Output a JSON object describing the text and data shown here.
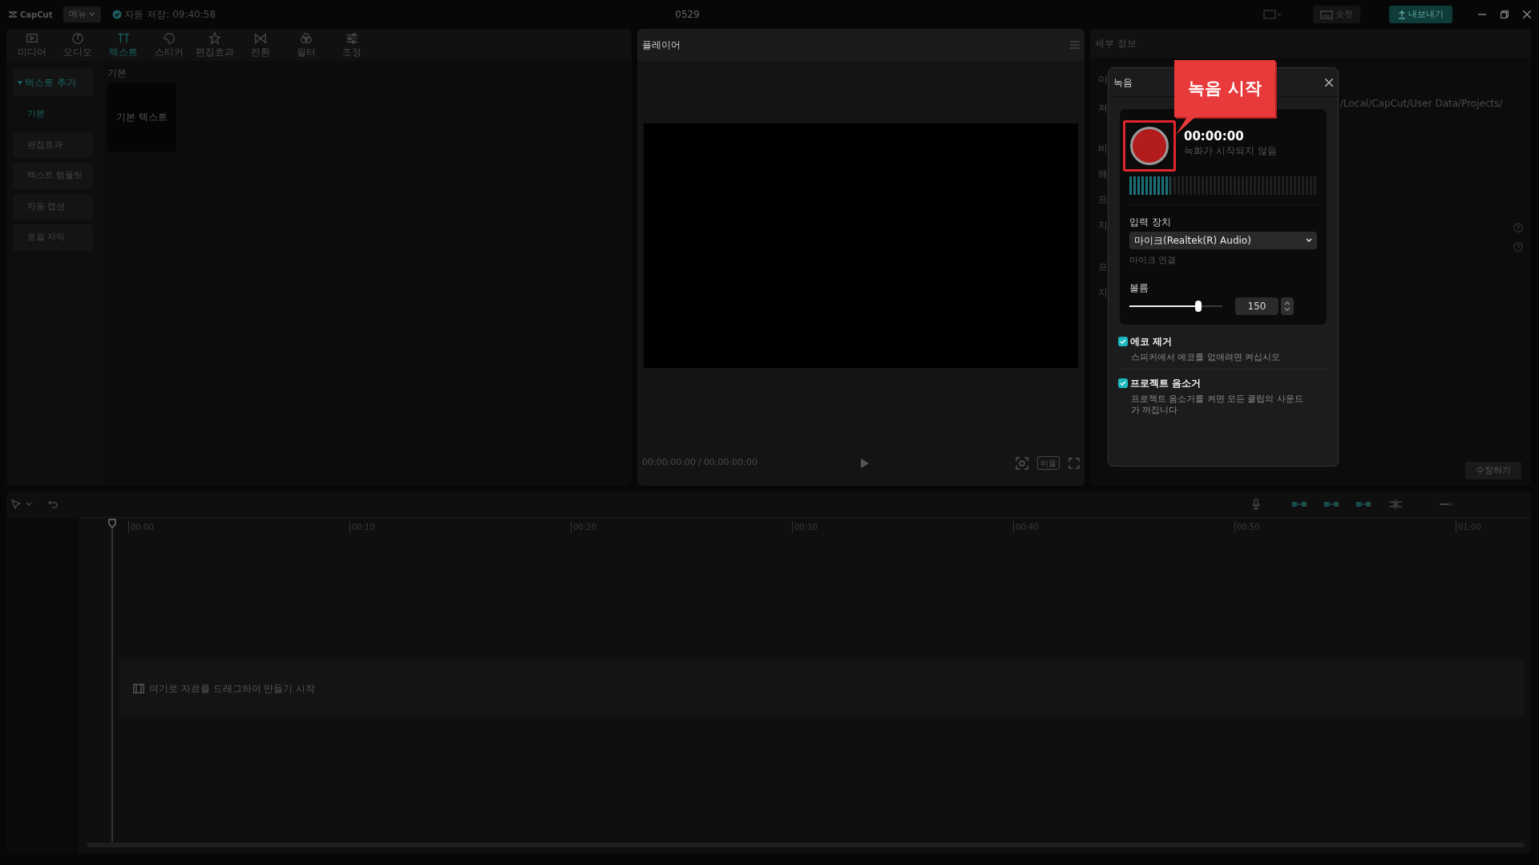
{
  "topbar": {
    "logo": "CapCut",
    "menu": "메뉴",
    "autosave": "자동 저장: 09:40:58",
    "project_title": "0529",
    "shortcut": "숏컷",
    "export": "내보내기"
  },
  "tool_tabs": [
    {
      "label": "미디어",
      "selected": false
    },
    {
      "label": "오디오",
      "selected": false
    },
    {
      "label": "텍스트",
      "selected": true
    },
    {
      "label": "스티커",
      "selected": false
    },
    {
      "label": "편집효과",
      "selected": false
    },
    {
      "label": "전환",
      "selected": false
    },
    {
      "label": "필터",
      "selected": false
    },
    {
      "label": "조정",
      "selected": false
    }
  ],
  "sidebar": {
    "group": {
      "label": "텍스트 추가",
      "expanded": true
    },
    "items": [
      {
        "label": "기본",
        "selected": true
      },
      {
        "label": "편집효과",
        "selected": false
      },
      {
        "label": "텍스트 템플릿",
        "selected": false
      },
      {
        "label": "자동 캡션",
        "selected": false
      },
      {
        "label": "로컬 자막",
        "selected": false
      }
    ]
  },
  "content": {
    "heading": "기본",
    "cards": [
      "기본 텍스트"
    ]
  },
  "player": {
    "title": "플레이어",
    "current_time": "00:00:00:00",
    "separator": "/",
    "total_time": "00:00:00:00",
    "ratio": "비율"
  },
  "details": {
    "title": "세부 정보",
    "labels": [
      "이",
      "저",
      "비",
      "해",
      "프",
      "지",
      "프",
      "지"
    ],
    "path": "/Local/CapCut/User Data/Projects/",
    "edit_button": "수정하기"
  },
  "timeline": {
    "ticks": [
      "00:00",
      "00:10",
      "00:20",
      "00:30",
      "00:40",
      "00:50",
      "01:00"
    ],
    "drop_hint": "여기로 자료를 드래그하여 만들기 시작"
  },
  "record_dialog": {
    "title": "녹음",
    "time": "00:00:00",
    "status": "녹화가 시작되지 않음",
    "meter": {
      "level": 0.22
    },
    "input_label": "입력 장치",
    "device": "마이크(Realtek(R) Audio)",
    "connect_hint": "마이크 연결",
    "volume_label": "볼륨",
    "volume": {
      "level": 0.74
    },
    "volume_value": "150",
    "options": [
      {
        "label": "에코 제거",
        "description": "스피커에서 에코를 없애려면 켜십시오",
        "checked": true
      },
      {
        "label": "프로젝트 음소거",
        "description": "프로젝트 음소거를 켜면 모든 클립의 사운드가 꺼집니다",
        "checked": true
      }
    ]
  },
  "annotation": {
    "text": "녹음 시작"
  }
}
